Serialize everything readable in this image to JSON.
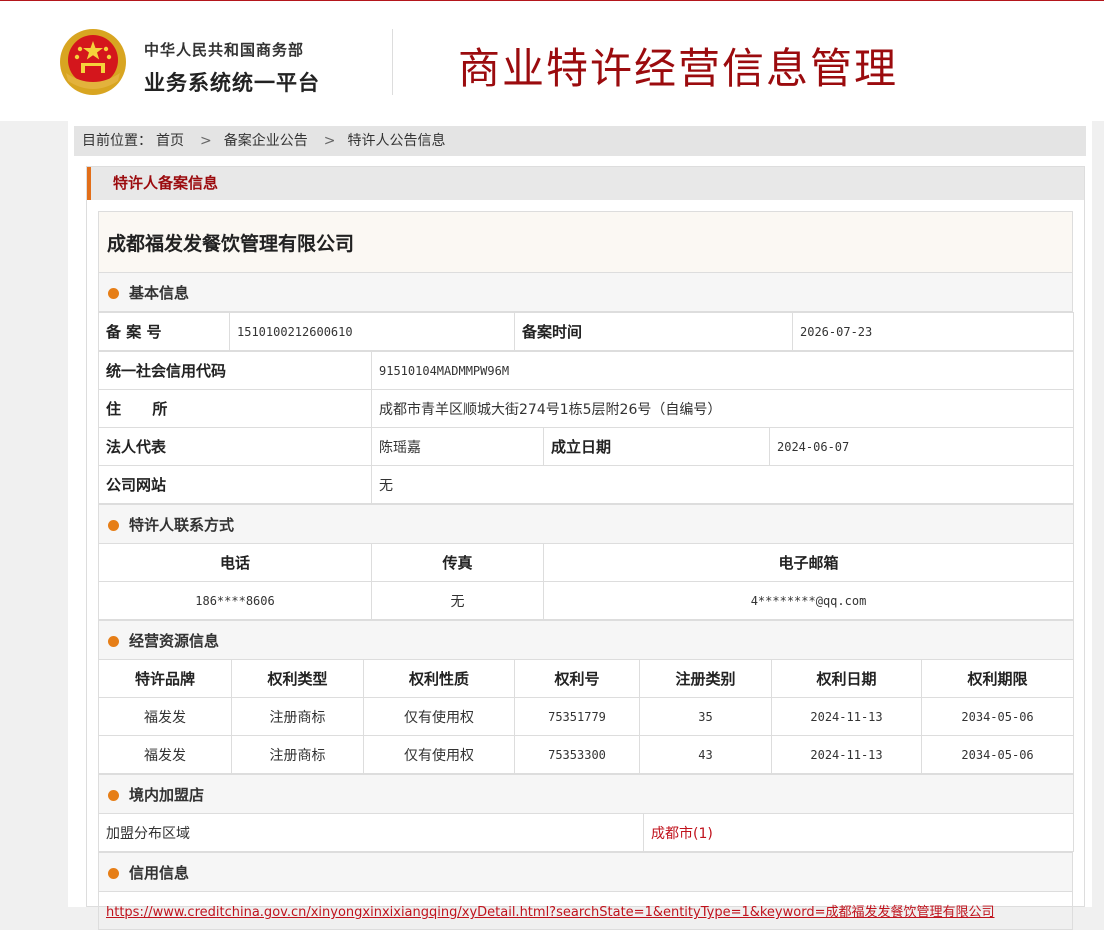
{
  "header": {
    "ministry": "中华人民共和国商务部",
    "platform": "业务系统统一平台",
    "system_title": "商业特许经营信息管理"
  },
  "breadcrumb": {
    "prefix": "目前位置：",
    "items": [
      "首页",
      "备案企业公告",
      "特许人公告信息"
    ]
  },
  "panel": {
    "title": "特许人备案信息"
  },
  "company": {
    "name": "成都福发发餐饮管理有限公司"
  },
  "basic": {
    "section_title": "基本信息",
    "record_no_label": "备 案 号",
    "record_no": "1510100212600610",
    "record_time_label": "备案时间",
    "record_time": "2026-07-23",
    "credit_code_label": "统一社会信用代码",
    "credit_code": "91510104MADMMPW96M",
    "address_label": "住      所",
    "address": "成都市青羊区顺城大街274号1栋5层附26号（自编号）",
    "legal_rep_label": "法人代表",
    "legal_rep": "陈瑶嘉",
    "founded_label": "成立日期",
    "founded": "2024-06-07",
    "website_label": "公司网站",
    "website": "无"
  },
  "contact": {
    "section_title": "特许人联系方式",
    "headers": [
      "电话",
      "传真",
      "电子邮箱"
    ],
    "phone": "186****8606",
    "fax": "无",
    "email": "4********@qq.com"
  },
  "resources": {
    "section_title": "经营资源信息",
    "headers": [
      "特许品牌",
      "权利类型",
      "权利性质",
      "权利号",
      "注册类别",
      "权利日期",
      "权利期限"
    ],
    "rows": [
      [
        "福发发",
        "注册商标",
        "仅有使用权",
        "75351779",
        "35",
        "2024-11-13",
        "2034-05-06"
      ],
      [
        "福发发",
        "注册商标",
        "仅有使用权",
        "75353300",
        "43",
        "2024-11-13",
        "2034-05-06"
      ]
    ]
  },
  "stores": {
    "section_title": "境内加盟店",
    "area_label": "加盟分布区域",
    "area_value": "成都市(1)"
  },
  "credit": {
    "section_title": "信用信息",
    "link": "https://www.creditchina.gov.cn/xinyongxinxixiangqing/xyDetail.html?searchState=1&entityType=1&keyword=成都福发发餐饮管理有限公司"
  },
  "colors": {
    "brand_red": "#9b0b0e",
    "accent_orange": "#e67e17",
    "link_red": "#c0121c"
  }
}
